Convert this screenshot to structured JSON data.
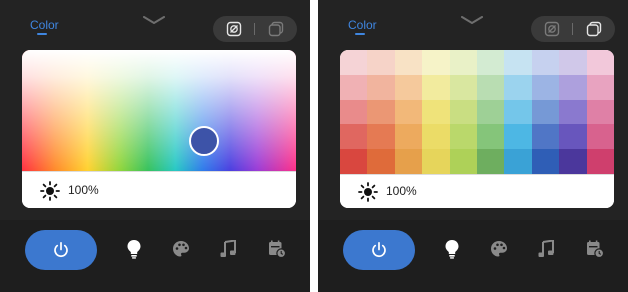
{
  "left_panel": {
    "tab_label": "Color",
    "brightness": "100%",
    "picker_color": "#3d53a8"
  },
  "right_panel": {
    "tab_label": "Color",
    "brightness": "100%",
    "swatches": [
      [
        "#f5d3d6",
        "#f6d3c8",
        "#f8e2c5",
        "#f6f3c8",
        "#e9f1c7",
        "#d3ebd2",
        "#c6e3f2",
        "#c6d1ef",
        "#d0c8e9",
        "#f2c8da"
      ],
      [
        "#f0b1b4",
        "#f1b49e",
        "#f5c99c",
        "#f2eb9e",
        "#d9e7a0",
        "#b9ddb2",
        "#9bd3ee",
        "#9cb4e4",
        "#ada0dd",
        "#e8a3c0"
      ],
      [
        "#e98b8b",
        "#eb9774",
        "#f2b879",
        "#efe37a",
        "#c9de82",
        "#9ed096",
        "#74c6ea",
        "#7699d6",
        "#8a79cf",
        "#df80a6"
      ],
      [
        "#e06760",
        "#e57a53",
        "#edaa5e",
        "#ebdc67",
        "#bad86b",
        "#85c57a",
        "#4db7e4",
        "#5076c6",
        "#6856bd",
        "#d8628e"
      ],
      [
        "#d9473f",
        "#df6b3a",
        "#e6a04b",
        "#e6d55b",
        "#aed158",
        "#6eae5f",
        "#3aa2d6",
        "#2f5eb6",
        "#4b379c",
        "#cf3f6d"
      ]
    ]
  },
  "icons": {
    "brightness": "sun-icon",
    "power": "power-icon",
    "scene": "bulb-icon",
    "color": "palette-icon",
    "music": "music-icon",
    "schedule": "schedule-icon"
  },
  "colors": {
    "accent": "#3f86e0",
    "power_button": "#3c78cf",
    "panel_bg": "#232323",
    "bottom_bar_bg": "#1e1e1e"
  }
}
